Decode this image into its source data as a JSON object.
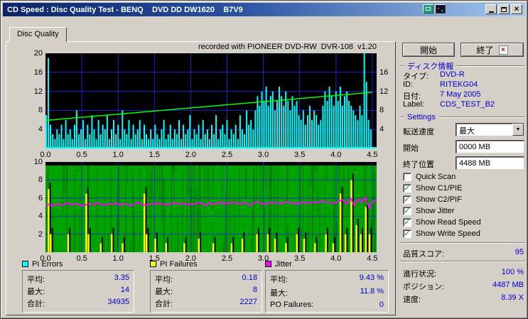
{
  "window": {
    "title": "CD Speed : Disc Quality Test - BENQ    DVD DD DW1620    B7V9",
    "tab": "Disc Quality"
  },
  "icons": {
    "close": "×",
    "combo_arrow": "▼",
    "check": "✓",
    "exit_x": "×"
  },
  "controls": {
    "start_button": "開始",
    "exit_button": "終了"
  },
  "disc_info": {
    "header": "ディスク情報",
    "rows": [
      {
        "label": "タイプ:",
        "value": "DVD-R"
      },
      {
        "label": "ID:",
        "value": "RITEKG04"
      },
      {
        "label": "日付:",
        "value": "7 May 2005"
      },
      {
        "label": "Label:",
        "value": "CDS_TEST_B2"
      }
    ]
  },
  "settings": {
    "header": "Settings",
    "transfer_label": "転送速度",
    "transfer_value": "最大",
    "start_label": "開始",
    "start_value": "0000 MB",
    "end_label": "終了位置",
    "end_value": "4488 MB",
    "checkboxes": [
      {
        "label": "Quick Scan",
        "checked": false
      },
      {
        "label": "Show C1/PIE",
        "checked": true
      },
      {
        "label": "Show C2/PIF",
        "checked": true
      },
      {
        "label": "Show Jitter",
        "checked": true
      },
      {
        "label": "Show Read Speed",
        "checked": true
      },
      {
        "label": "Show Write Speed",
        "checked": true
      }
    ]
  },
  "status": {
    "score_label": "品質スコア:",
    "score_value": "95",
    "progress_label": "進行状況:",
    "progress_value": "100 %",
    "position_label": "ポジション:",
    "position_value": "4487 MB",
    "speed_label": "速度:",
    "speed_value": "8.39 X"
  },
  "stats_boxes": [
    {
      "name": "PI Errors",
      "color": "#00ffff",
      "rows": [
        {
          "label": "平均:",
          "value": "3.35"
        },
        {
          "label": "最大:",
          "value": "14"
        },
        {
          "label": "合計:",
          "value": "34935"
        }
      ]
    },
    {
      "name": "PI Failures",
      "color": "#ffff00",
      "rows": [
        {
          "label": "平均:",
          "value": "0.18"
        },
        {
          "label": "最大:",
          "value": "8"
        },
        {
          "label": "合計:",
          "value": "2227"
        }
      ]
    },
    {
      "name": "Jitter",
      "color": "#ff00ff",
      "rows": [
        {
          "label": "平均:",
          "value": "9.43 %"
        },
        {
          "label": "最大:",
          "value": "11.8 %"
        },
        {
          "label": "PO Failures:",
          "value": "0"
        }
      ]
    }
  ],
  "chart_data": [
    {
      "type": "bar",
      "name": "PI Errors with Write Speed overlay",
      "annotation": "recorded with PIONEER DVD-RW  DVR-108  v1.20",
      "bg": "#000000",
      "grid_color": "#2222cc",
      "bar_color": "#00ffff",
      "line_color": "#00ff00",
      "x_range": [
        0,
        4.56
      ],
      "y_range": [
        0,
        20
      ],
      "x_tick_labels": [
        "0.0",
        "0.5",
        "1.0",
        "1.5",
        "2.0",
        "2.5",
        "3.0",
        "3.5",
        "4.0",
        "4.5"
      ],
      "y_ticks_left": [
        20,
        16,
        12,
        8,
        4
      ],
      "y_ticks_right": [
        16,
        12,
        8,
        4
      ],
      "bars_x_step": 0.03,
      "bars": [
        7,
        19,
        5,
        3,
        2,
        4,
        3,
        5,
        2,
        6,
        3,
        4,
        2,
        5,
        8,
        3,
        4,
        6,
        2,
        5,
        3,
        7,
        4,
        2,
        6,
        3,
        5,
        4,
        7,
        2,
        4,
        6,
        3,
        5,
        2,
        8,
        4,
        3,
        6,
        2,
        5,
        3,
        4,
        6,
        2,
        5,
        3,
        2,
        4,
        2,
        5,
        3,
        2,
        4,
        6,
        2,
        3,
        5,
        2,
        4,
        3,
        6,
        2,
        5,
        3,
        4,
        7,
        2,
        4,
        3,
        5,
        2,
        6,
        3,
        4,
        2,
        5,
        3,
        7,
        2,
        4,
        5,
        3,
        6,
        2,
        4,
        3,
        5,
        2,
        7,
        4,
        3,
        8,
        5,
        6,
        4,
        8,
        11,
        9,
        12,
        10,
        13,
        9,
        11,
        12,
        8,
        10,
        13,
        11,
        9,
        12,
        10,
        8,
        11,
        9,
        10,
        7,
        6,
        8,
        5,
        7,
        9,
        6,
        8,
        7,
        5,
        6,
        9,
        12,
        10,
        13,
        11,
        9,
        12,
        10,
        13,
        9,
        11,
        12,
        10,
        9,
        8,
        7,
        6,
        9,
        7,
        20,
        14,
        6,
        4
      ],
      "write_speed_line": {
        "x": [
          0,
          4.5
        ],
        "y": [
          5.9,
          11.8
        ]
      }
    },
    {
      "type": "bar",
      "name": "PI Failures with Jitter overlay",
      "bg": "#00a400",
      "grid_color": "#2222cc",
      "bar_color": "#ffff00",
      "line_color": "#ff00ff",
      "x_range": [
        0,
        4.56
      ],
      "y_range": [
        0,
        10
      ],
      "x_tick_labels": [
        "0.0",
        "0.5",
        "1.0",
        "1.5",
        "2.0",
        "2.5",
        "3.0",
        "3.5",
        "4.0",
        "4.5"
      ],
      "y_ticks_left": [
        10,
        8,
        6,
        4,
        2
      ],
      "pif_bars": [
        [
          0.03,
          7
        ],
        [
          0.06,
          2
        ],
        [
          0.3,
          2
        ],
        [
          0.55,
          6.5
        ],
        [
          0.58,
          2
        ],
        [
          0.75,
          1
        ],
        [
          0.9,
          2
        ],
        [
          1.05,
          1
        ],
        [
          1.35,
          6.5
        ],
        [
          1.38,
          2
        ],
        [
          1.5,
          1.5
        ],
        [
          1.65,
          1
        ],
        [
          1.9,
          1
        ],
        [
          2.1,
          1.5
        ],
        [
          2.3,
          1
        ],
        [
          2.55,
          1
        ],
        [
          2.7,
          1.5
        ],
        [
          2.9,
          2
        ],
        [
          3.05,
          2
        ],
        [
          3.15,
          1.5
        ],
        [
          3.3,
          1
        ],
        [
          3.45,
          2
        ],
        [
          3.55,
          1.5
        ],
        [
          3.7,
          1
        ],
        [
          3.85,
          2
        ],
        [
          3.95,
          1
        ],
        [
          4.05,
          6.5
        ],
        [
          4.12,
          2
        ],
        [
          4.2,
          8
        ],
        [
          4.27,
          3
        ],
        [
          4.33,
          2
        ],
        [
          4.4,
          5
        ],
        [
          4.45,
          2
        ]
      ],
      "jitter_line": [
        5.2,
        5.3,
        5.1,
        5.4,
        5.2,
        5.3,
        5.5,
        5.2,
        5.4,
        5.3,
        5.1,
        5.3,
        5.4,
        5.2,
        5.5,
        5.3,
        5.2,
        5.4,
        5.3,
        5.5,
        5.2,
        5.4,
        5.3,
        5.1,
        5.4,
        5.5,
        5.3,
        5.2,
        5.4,
        5.3,
        5.5,
        5.3,
        5.4,
        5.2,
        5.5,
        5.4,
        5.3,
        5.5,
        5.2,
        5.4,
        5.3,
        5.5,
        5.4,
        5.2,
        5.5,
        5.3,
        5.4,
        5.6,
        5.3,
        5.5,
        5.4,
        5.6,
        5.3,
        5.5,
        5.4,
        5.2,
        5.5,
        5.6,
        5.4,
        5.3,
        5.5,
        5.4,
        5.6,
        5.3,
        5.5,
        5.6,
        5.4,
        5.5,
        5.3,
        5.6,
        5.4,
        5.5,
        5.6,
        5.4,
        5.7,
        5.5,
        5.6,
        5.4,
        5.5,
        5.7,
        5.8,
        5.3,
        6.0,
        5.2,
        5.9,
        5.5,
        6.1,
        4.9,
        5.6,
        5.8
      ]
    }
  ]
}
